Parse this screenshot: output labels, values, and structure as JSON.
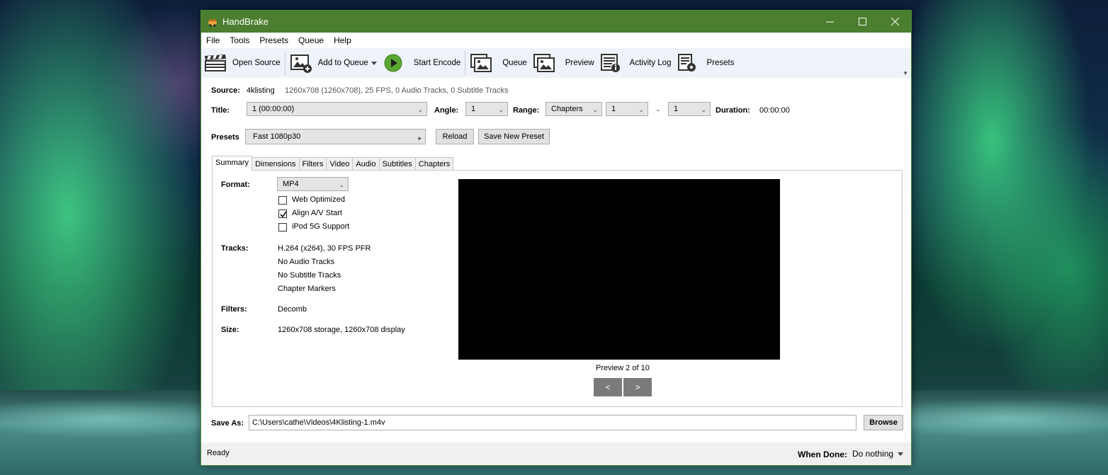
{
  "window": {
    "title": "HandBrake",
    "controls": [
      "minimize-icon",
      "maximize-icon",
      "close-icon"
    ]
  },
  "menu": [
    "File",
    "Tools",
    "Presets",
    "Queue",
    "Help"
  ],
  "toolbar": {
    "open_source": "Open Source",
    "add_to_queue": "Add to Queue",
    "start_encode": "Start Encode",
    "queue": "Queue",
    "preview": "Preview",
    "activity_log": "Activity Log",
    "presets": "Presets"
  },
  "source": {
    "label": "Source:",
    "name": "4klisting",
    "info": "1260x708 (1260x708), 25 FPS, 0 Audio Tracks, 0 Subtitle Tracks"
  },
  "title_row": {
    "title_label": "Title:",
    "title_value": "1 (00:00:00)",
    "angle_label": "Angle:",
    "angle_value": "1",
    "range_label": "Range:",
    "range_type": "Chapters",
    "range_start": "1",
    "range_dash": "-",
    "range_end": "1",
    "duration_label": "Duration:",
    "duration_value": "00:00:00"
  },
  "presets_row": {
    "label": "Presets",
    "value": "Fast 1080p30",
    "reload": "Reload",
    "save_new": "Save New Preset"
  },
  "tabs": [
    "Summary",
    "Dimensions",
    "Filters",
    "Video",
    "Audio",
    "Subtitles",
    "Chapters"
  ],
  "summary": {
    "format_label": "Format:",
    "format_value": "MP4",
    "web_optimized": {
      "label": "Web Optimized",
      "checked": false
    },
    "align_av": {
      "label": "Align A/V Start",
      "checked": true
    },
    "ipod": {
      "label": "iPod 5G Support",
      "checked": false
    },
    "tracks_label": "Tracks:",
    "tracks": [
      "H.264 (x264), 30 FPS PFR",
      "No Audio Tracks",
      "No Subtitle Tracks",
      "Chapter Markers"
    ],
    "filters_label": "Filters:",
    "filters_value": "Decomb",
    "size_label": "Size:",
    "size_value": "1260x708 storage, 1260x708 display",
    "preview_caption": "Preview 2 of 10",
    "prev_btn": "<",
    "next_btn": ">"
  },
  "save_as": {
    "label": "Save As:",
    "path": "C:\\Users\\cathe\\Videos\\4Klisting-1.m4v",
    "browse": "Browse"
  },
  "status": {
    "text": "Ready",
    "when_done_label": "When Done:",
    "when_done_value": "Do nothing"
  },
  "colors": {
    "titlebar": "#4b7e2f",
    "toolbar_bg": "#eef3f9",
    "play_green": "#5aa832"
  }
}
